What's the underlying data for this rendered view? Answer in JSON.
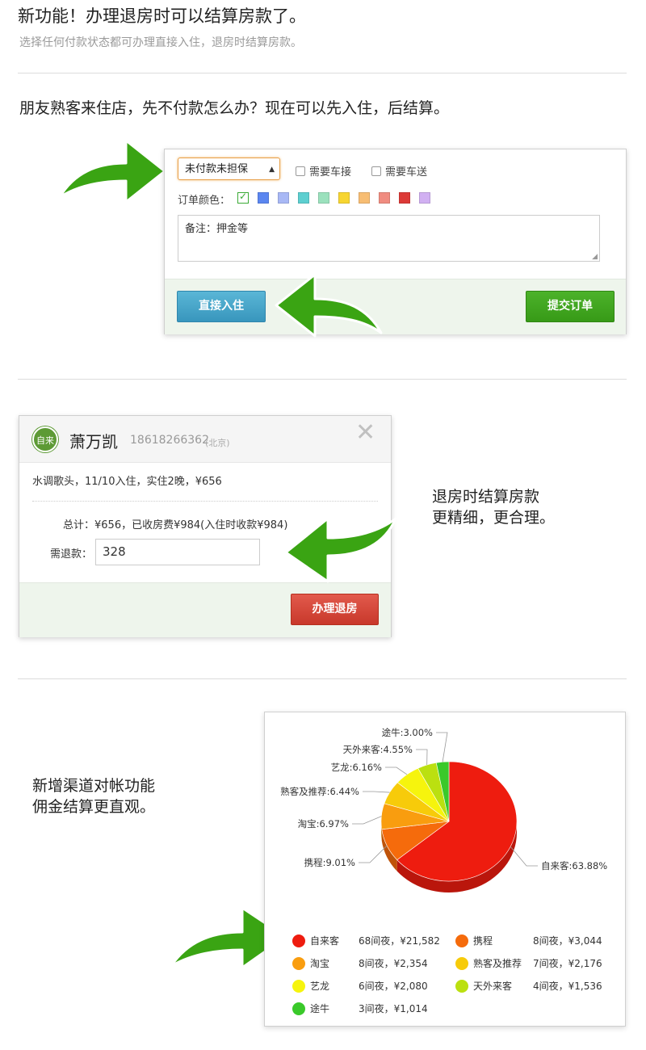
{
  "header": {
    "title": "新功能！办理退房时可以结算房款了。",
    "subtitle": "选择任何付款状态都可办理直接入住，退房时结算房款。"
  },
  "section1": {
    "lead": "朋友熟客来住店，先不付款怎么办？现在可以先入住，后结算。",
    "payment_select": "未付款未担保",
    "checkbox_pickup": "需要车接",
    "checkbox_dropoff": "需要车送",
    "color_label": "订单颜色：",
    "colors": [
      "#3aaa35",
      "#5b86f0",
      "#a8b8f5",
      "#5dcfd0",
      "#9be1bd",
      "#f7d531",
      "#f7bd73",
      "#f08c80",
      "#dc3a37",
      "#d1b0f2"
    ],
    "remark": "备注：押金等",
    "checkin_button": "直接入住",
    "submit_button": "提交订单"
  },
  "section2": {
    "avatar_text": "自来",
    "guest_name": "萧万凯",
    "phone": "18618266362",
    "city": "(北京)",
    "stay_info": "水调歌头，11/10入住，实住2晚，¥656",
    "total": "总计：¥656，已收房费¥984(入住时收款¥984)",
    "refund_label": "需退款：",
    "refund_value": "328",
    "checkout_button": "办理退房",
    "side_line1": "退房时结算房款",
    "side_line2": "更精细，更合理。"
  },
  "section3": {
    "side_line1": "新增渠道对帐功能",
    "side_line2": "佣金结算更直观。"
  },
  "chart_data": {
    "type": "pie",
    "slices": [
      {
        "name": "自来客",
        "percent": 63.88,
        "label": "自来客:63.88%",
        "legend_value": "68间夜，¥21,582",
        "color": "#ee1c0f"
      },
      {
        "name": "携程",
        "percent": 9.01,
        "label": "携程:9.01%",
        "legend_value": "8间夜，¥3,044",
        "color": "#f56b0c"
      },
      {
        "name": "淘宝",
        "percent": 6.97,
        "label": "淘宝:6.97%",
        "legend_value": "8间夜，¥2,354",
        "color": "#f99d0f"
      },
      {
        "name": "熟客及推荐",
        "percent": 6.44,
        "label": "熟客及推荐:6.44%",
        "legend_value": "7间夜，¥2,176",
        "color": "#f7cb0a"
      },
      {
        "name": "艺龙",
        "percent": 6.16,
        "label": "艺龙:6.16%",
        "legend_value": "6间夜，¥2,080",
        "color": "#f6f40d"
      },
      {
        "name": "天外来客",
        "percent": 4.55,
        "label": "天外来客:4.55%",
        "legend_value": "4间夜，¥1,536",
        "color": "#bbe010"
      },
      {
        "name": "途牛",
        "percent": 3.0,
        "label": "途牛:3.00%",
        "legend_value": "3间夜，¥1,014",
        "color": "#3ac92a"
      }
    ]
  }
}
